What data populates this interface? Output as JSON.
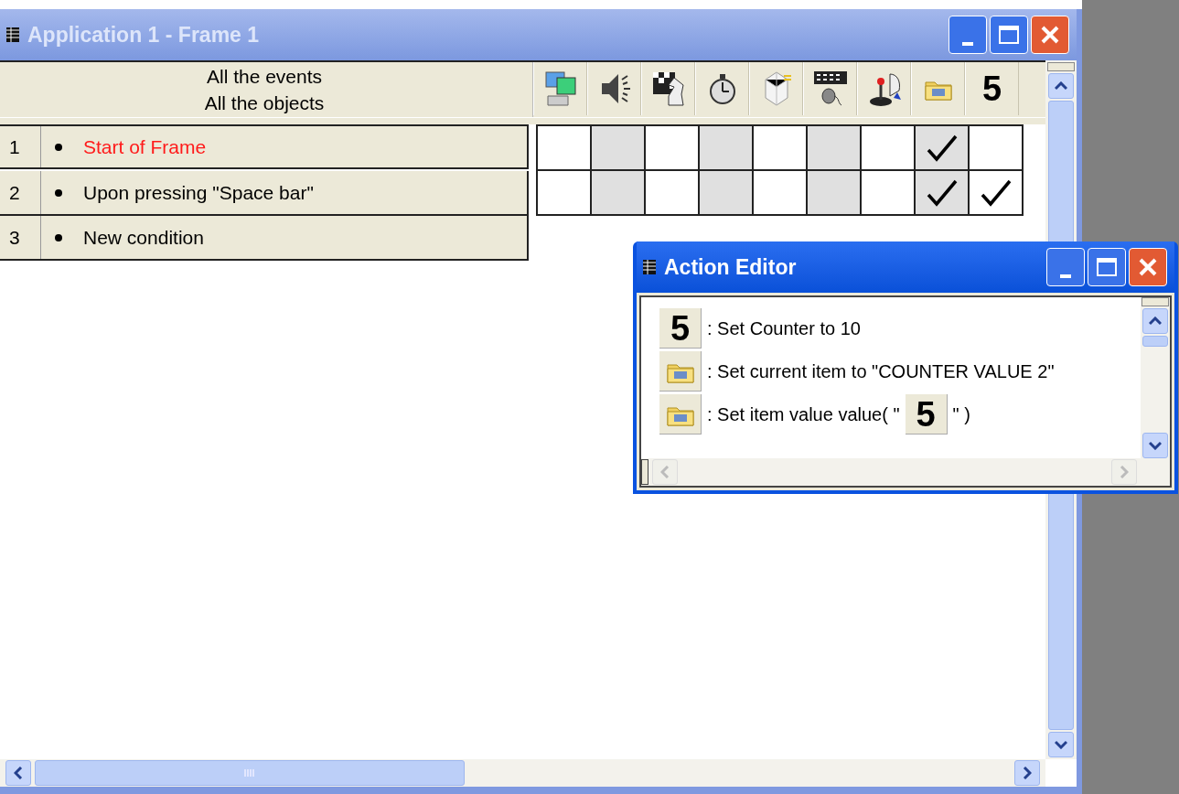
{
  "main_window": {
    "title": "Application 1 - Frame 1",
    "active": false,
    "header": {
      "line_1": "All the events",
      "line_2": "All the objects"
    },
    "object_columns": [
      {
        "kind": "system"
      },
      {
        "kind": "sound"
      },
      {
        "kind": "storyboard"
      },
      {
        "kind": "timer"
      },
      {
        "kind": "special"
      },
      {
        "kind": "keyboard"
      },
      {
        "kind": "player"
      },
      {
        "kind": "ini"
      },
      {
        "kind": "counter",
        "label": "5"
      }
    ],
    "events": [
      {
        "number": "1",
        "text": "Start of Frame",
        "highlighted": true,
        "checks": [
          false,
          false,
          false,
          false,
          false,
          false,
          false,
          true,
          false
        ]
      },
      {
        "number": "2",
        "text": "Upon pressing \"Space bar\"",
        "highlighted": false,
        "checks": [
          false,
          false,
          false,
          false,
          false,
          false,
          false,
          true,
          true
        ]
      },
      {
        "number": "3",
        "text": "New condition",
        "highlighted": false
      }
    ]
  },
  "action_editor": {
    "title": "Action Editor",
    "active": true,
    "actions": [
      {
        "kind": "counter",
        "icon_label": "5",
        "parts": [
          {
            "kind": "text",
            "text": ": Set Counter to 10"
          }
        ]
      },
      {
        "kind": "ini",
        "parts": [
          {
            "kind": "text",
            "text": ": Set current item to \"COUNTER VALUE 2\""
          }
        ]
      },
      {
        "kind": "ini",
        "parts": [
          {
            "kind": "text",
            "text": ": Set item value value( \""
          },
          {
            "kind": "counter",
            "label": "5"
          },
          {
            "kind": "text",
            "text": "\" )"
          }
        ]
      }
    ]
  }
}
